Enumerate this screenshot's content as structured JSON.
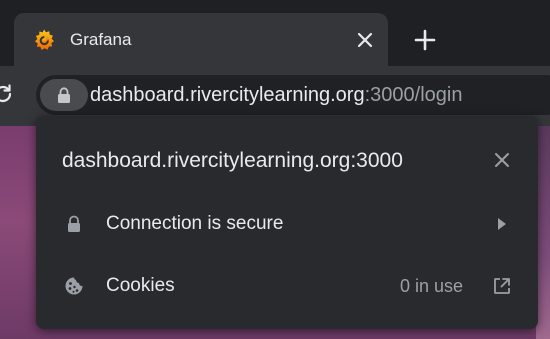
{
  "tab": {
    "title": "Grafana",
    "favicon": "grafana-logo-icon",
    "close_icon": "close-icon"
  },
  "new_tab_icon": "plus-icon",
  "toolbar": {
    "reload_icon": "reload-icon",
    "lock_icon": "lock-icon",
    "url_host": "dashboard.rivercitylearning.org",
    "url_rest": ":3000/login"
  },
  "popup": {
    "host": "dashboard.rivercitylearning.org:3000",
    "close_icon": "close-icon",
    "rows": [
      {
        "label": "Connection is secure",
        "icon": "lock-icon",
        "trailing_icon": "chevron-right-icon"
      },
      {
        "label": "Cookies",
        "icon": "cookie-icon",
        "value": "0 in use",
        "trailing_icon": "open-in-new-icon"
      }
    ]
  },
  "colors": {
    "grafana_orange": "#f46800",
    "grafana_yellow": "#fbc81f",
    "popup_bg": "#292a2d",
    "toolbar_bg": "#35363a",
    "text_primary": "#e8eaed",
    "text_secondary": "#9aa0a6"
  }
}
